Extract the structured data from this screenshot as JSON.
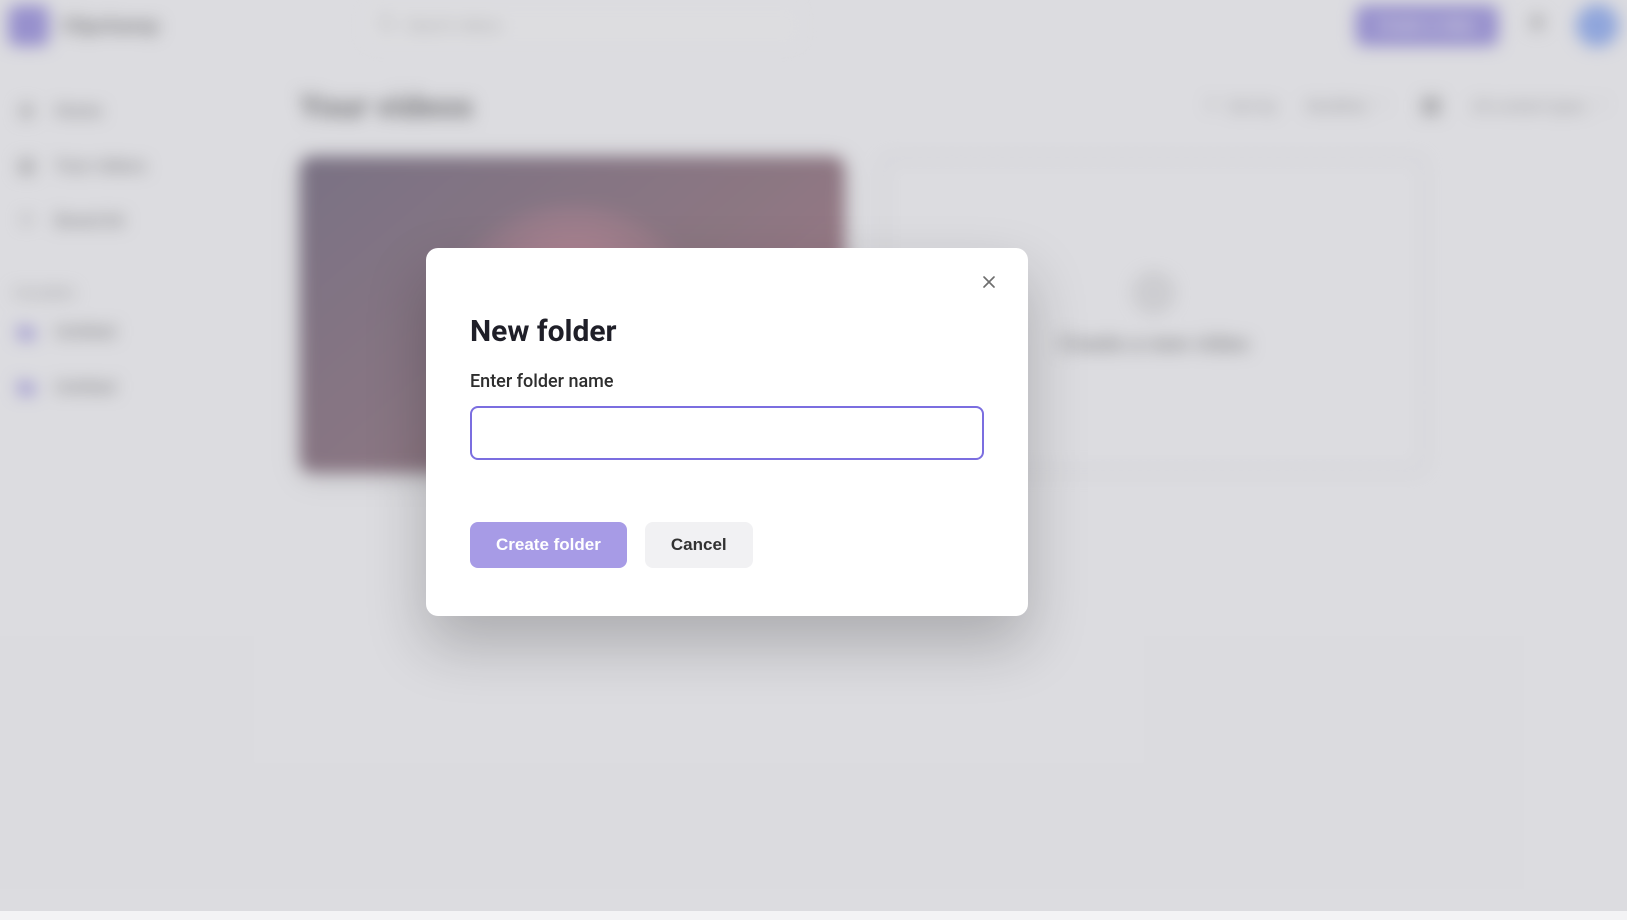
{
  "brand": {
    "name": "Clipchamp"
  },
  "search": {
    "placeholder": "Search videos"
  },
  "topbar": {
    "primary_button": "Create a video",
    "notifications_icon": "bell-icon"
  },
  "sidebar": {
    "items": [
      {
        "icon": "home",
        "label": "Home"
      },
      {
        "icon": "clapper",
        "label": "Your videos"
      },
      {
        "icon": "sparkle",
        "label": "Brand kit"
      }
    ],
    "section_label": "FOLDERS",
    "folders": [
      {
        "label": "Untitled"
      },
      {
        "label": "Untitled"
      }
    ]
  },
  "page": {
    "title": "Your videos",
    "sort_by_label": "Modified",
    "filter_label": "Sort by",
    "view_mode": "grid",
    "type_filter": "All content types"
  },
  "cards": {
    "upload_text": "Create a new video"
  },
  "modal": {
    "title": "New folder",
    "input_label": "Enter folder name",
    "input_value": "",
    "create_button": "Create folder",
    "cancel_button": "Cancel"
  }
}
